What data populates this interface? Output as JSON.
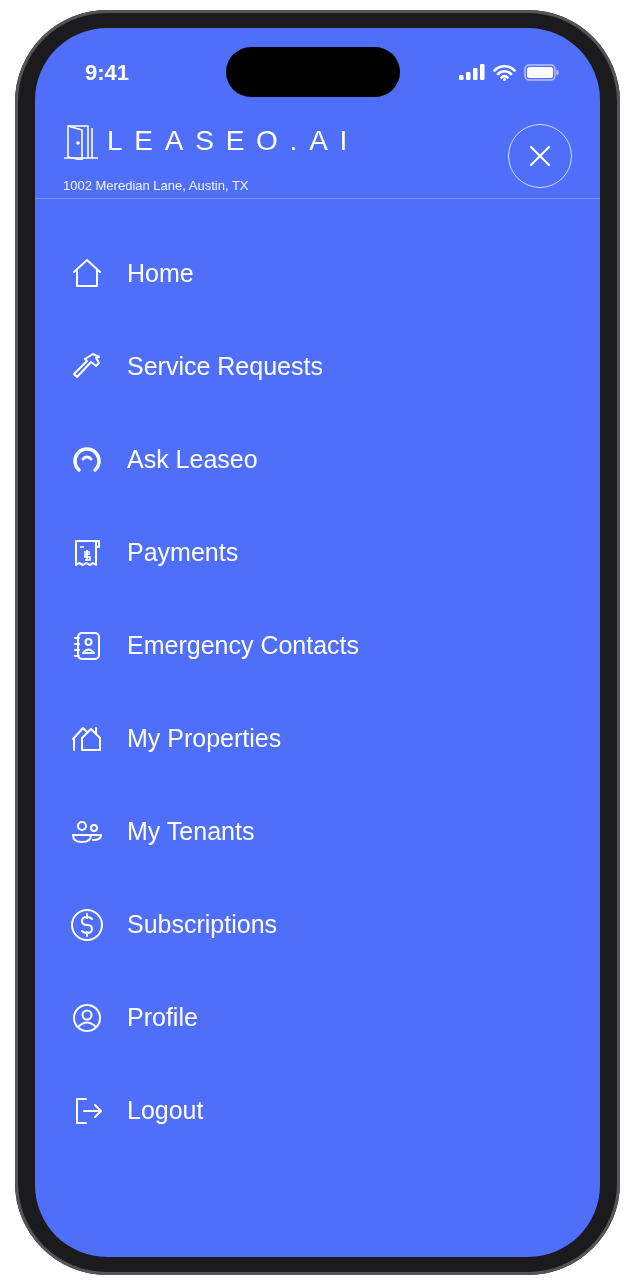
{
  "status_bar": {
    "time": "9:41"
  },
  "header": {
    "logo": "LEASEO.AI",
    "address": "1002 Meredian Lane, Austin, TX"
  },
  "menu": {
    "items": [
      {
        "label": "Home"
      },
      {
        "label": "Service Requests"
      },
      {
        "label": "Ask Leaseo"
      },
      {
        "label": "Payments"
      },
      {
        "label": "Emergency Contacts"
      },
      {
        "label": "My Properties"
      },
      {
        "label": "My Tenants"
      },
      {
        "label": "Subscriptions"
      },
      {
        "label": "Profile"
      },
      {
        "label": "Logout"
      }
    ]
  }
}
